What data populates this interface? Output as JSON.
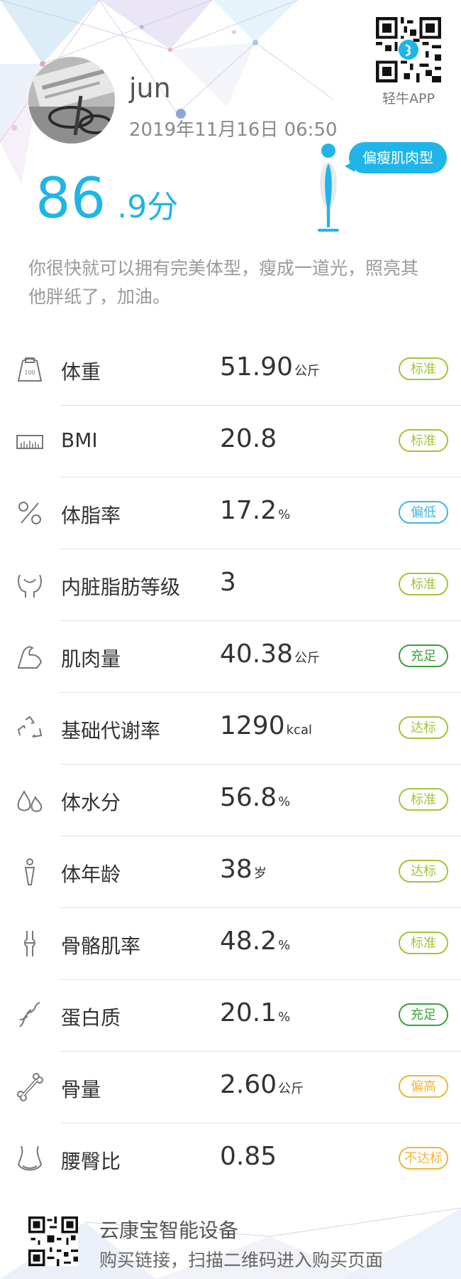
{
  "profile": {
    "name": "jun",
    "datetime": "2019年11月16日 06:50"
  },
  "app": {
    "qr_caption": "轻牛APP"
  },
  "score": {
    "integer": "86",
    "decimal": ".9",
    "unit": "分"
  },
  "body_type": "偏瘦肌肉型",
  "summary": "你很快就可以拥有完美体型，瘦成一道光，照亮其他胖纸了，加油。",
  "metrics": [
    {
      "icon": "scale-icon",
      "name": "体重",
      "value": "51.90",
      "unit": "公斤",
      "status": "标准",
      "status_color": "#a2c43a"
    },
    {
      "icon": "bmi-chart-icon",
      "name": "BMI",
      "value": "20.8",
      "unit": "",
      "status": "标准",
      "status_color": "#a2c43a"
    },
    {
      "icon": "percent-icon",
      "name": "体脂率",
      "value": "17.2",
      "unit": "%",
      "status": "偏低",
      "status_color": "#3fb6e0"
    },
    {
      "icon": "organ-icon",
      "name": "内脏脂肪等级",
      "value": "3",
      "unit": "",
      "status": "标准",
      "status_color": "#a2c43a"
    },
    {
      "icon": "muscle-arm-icon",
      "name": "肌肉量",
      "value": "40.38",
      "unit": "公斤",
      "status": "充足",
      "status_color": "#3aa33a"
    },
    {
      "icon": "recycle-icon",
      "name": "基础代谢率",
      "value": "1290",
      "unit": "kcal",
      "status": "达标",
      "status_color": "#a2c43a"
    },
    {
      "icon": "water-drops-icon",
      "name": "体水分",
      "value": "56.8",
      "unit": "%",
      "status": "标准",
      "status_color": "#a2c43a"
    },
    {
      "icon": "person-icon",
      "name": "体年龄",
      "value": "38",
      "unit": "岁",
      "status": "达标",
      "status_color": "#a2c43a"
    },
    {
      "icon": "bone-joint-icon",
      "name": "骨骼肌率",
      "value": "48.2",
      "unit": "%",
      "status": "标准",
      "status_color": "#a2c43a"
    },
    {
      "icon": "dna-icon",
      "name": "蛋白质",
      "value": "20.1",
      "unit": "%",
      "status": "充足",
      "status_color": "#3aa33a"
    },
    {
      "icon": "bone-icon",
      "name": "骨量",
      "value": "2.60",
      "unit": "公斤",
      "status": "偏高",
      "status_color": "#f0b43c"
    },
    {
      "icon": "waist-icon",
      "name": "腰臀比",
      "value": "0.85",
      "unit": "",
      "status": "不达标",
      "status_color": "#f0b43c"
    }
  ],
  "footer": {
    "title": "云康宝智能设备",
    "subtitle": "购买链接，扫描二维码进入购买页面"
  },
  "colors": {
    "accent": "#1fb5e8",
    "text": "#333333",
    "muted": "#9a9a9a"
  }
}
